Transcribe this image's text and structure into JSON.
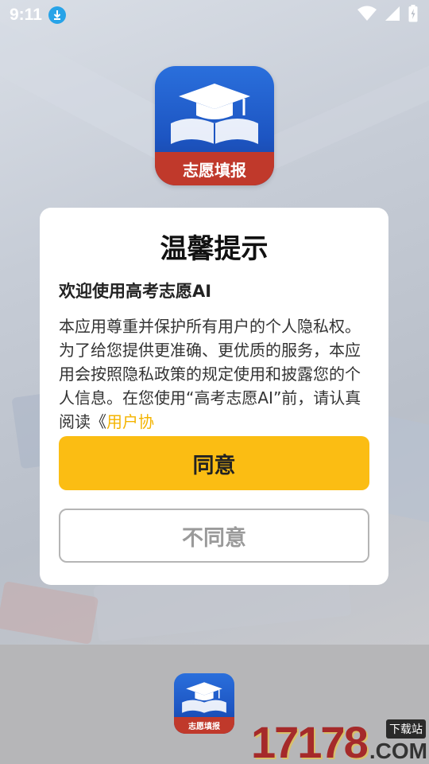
{
  "status_bar": {
    "time": "9:11"
  },
  "app": {
    "icon_label": "志愿填报"
  },
  "dialog": {
    "title": "温馨提示",
    "subtitle": "欢迎使用高考志愿AI",
    "body_text": "本应用尊重并保护所有用户的个人隐私权。为了给您提供更准确、更优质的服务，本应用会按照隐私政策的规定使用和披露您的个人信息。在您使用“高考志愿AI”前，请认真阅读《",
    "body_link": "用户协",
    "agree_label": "同意",
    "disagree_label": "不同意"
  },
  "watermark": {
    "number": "17178",
    "tag": "下载站",
    "suffix": ".COM"
  },
  "colors": {
    "accent": "#fbbd13",
    "link": "#f4b400",
    "icon_blue": "#1d55c2",
    "icon_banner": "#c0392b"
  }
}
